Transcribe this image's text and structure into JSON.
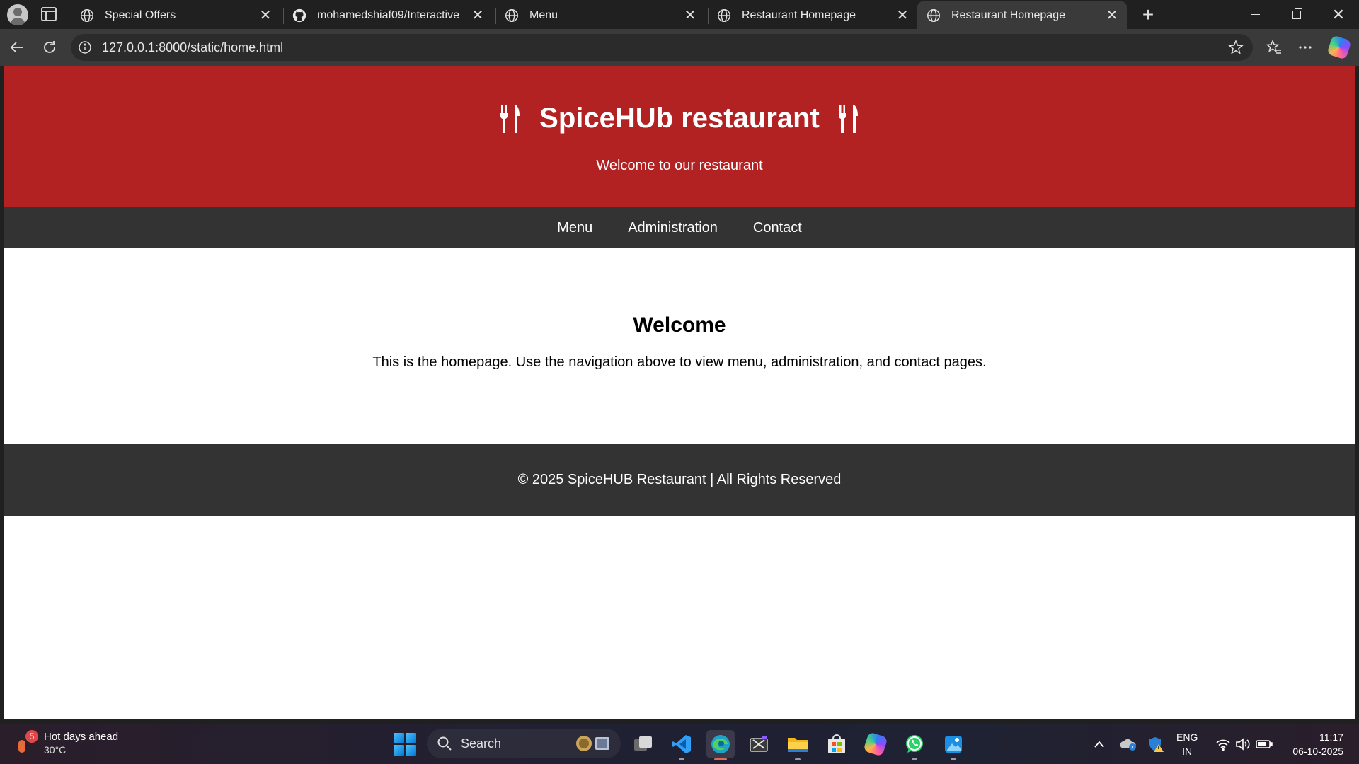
{
  "browser": {
    "tabs": [
      {
        "title": "Special Offers",
        "icon": "globe-icon",
        "active": false
      },
      {
        "title": "mohamedshiaf09/Interactive",
        "icon": "github-icon",
        "active": false
      },
      {
        "title": "Menu",
        "icon": "globe-icon",
        "active": false
      },
      {
        "title": "Restaurant Homepage",
        "icon": "globe-icon",
        "active": false
      },
      {
        "title": "Restaurant Homepage",
        "icon": "globe-icon",
        "active": true
      }
    ],
    "close_glyph": "✕",
    "new_tab_glyph": "+",
    "address": "127.0.0.1:8000/static/home.html"
  },
  "page": {
    "hero_title": "SpiceHUb restaurant",
    "hero_subtitle": "Welcome to our restaurant",
    "nav": [
      {
        "label": "Menu"
      },
      {
        "label": "Administration"
      },
      {
        "label": "Contact"
      }
    ],
    "welcome_heading": "Welcome",
    "welcome_text": "This is the homepage. Use the navigation above to view menu, administration, and contact pages.",
    "footer_text": "© 2025 SpiceHUB Restaurant | All Rights Reserved",
    "colors": {
      "hero": "#b22222",
      "nav": "#333333"
    }
  },
  "taskbar": {
    "weather_title": "Hot days ahead",
    "weather_temp": "30°C",
    "weather_badge": "5",
    "search_label": "Search",
    "lang_line1": "ENG",
    "lang_line2": "IN",
    "time": "11:17",
    "date": "06-10-2025"
  }
}
